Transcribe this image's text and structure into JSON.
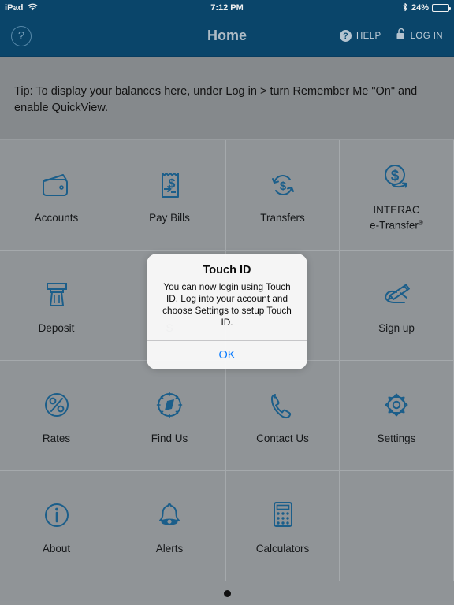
{
  "status_bar": {
    "device": "iPad",
    "wifi_icon": "wifi-icon",
    "time": "7:12 PM",
    "bluetooth_icon": "bluetooth-icon",
    "battery_percent": "24%",
    "battery_level": 24
  },
  "nav_bar": {
    "help_circle_icon": "question-mark-circle-icon",
    "help_circle_glyph": "?",
    "title": "Home",
    "help_label": "HELP",
    "help_icon": "question-mark-filled-icon",
    "help_glyph": "?",
    "login_label": "LOG IN",
    "login_icon": "unlocked-padlock-icon"
  },
  "tip": {
    "text": "Tip: To display your balances here, under Log in > turn Remember Me \"On\" and enable QuickView."
  },
  "grid": {
    "items": [
      {
        "label": "Accounts",
        "icon": "wallet-icon"
      },
      {
        "label": "Pay Bills",
        "icon": "bill-receipt-dollar-icon"
      },
      {
        "label": "Transfers",
        "icon": "transfer-arrows-dollar-icon"
      },
      {
        "label": "INTERAC\ne-Transfer",
        "label_line1": "INTERAC",
        "label_line2": "e-Transfer",
        "superscript": "®",
        "icon": "interac-dollar-circle-arrow-icon"
      },
      {
        "label": "Deposit",
        "icon": "cheque-deposit-slot-icon"
      },
      {
        "label": "S",
        "icon": "hidden-behind-dialog",
        "obscured": true
      },
      {
        "label": "",
        "icon": "hidden-behind-dialog",
        "obscured": true
      },
      {
        "label": "Sign up",
        "icon": "hand-writing-pen-icon"
      },
      {
        "label": "Rates",
        "icon": "percent-circle-icon"
      },
      {
        "label": "Find Us",
        "icon": "compass-icon"
      },
      {
        "label": "Contact Us",
        "icon": "phone-handset-icon"
      },
      {
        "label": "Settings",
        "icon": "gear-icon"
      },
      {
        "label": "About",
        "icon": "info-circle-icon"
      },
      {
        "label": "Alerts",
        "icon": "bell-icon"
      },
      {
        "label": "Calculators",
        "icon": "calculator-icon"
      },
      {
        "label": "",
        "icon": "",
        "empty": true
      }
    ]
  },
  "alert": {
    "title": "Touch ID",
    "message": "You can now login using Touch ID. Log into your account and choose Settings to setup Touch ID.",
    "ok_label": "OK"
  },
  "page_indicator": {
    "pages": 1,
    "current": 1
  },
  "colors": {
    "nav_blue": "#0b4a71",
    "icon_blue": "#1d6493",
    "background_gray": "#9a9ea1",
    "banner_gray": "#8e9295",
    "alert_accent": "#0a7cff"
  }
}
